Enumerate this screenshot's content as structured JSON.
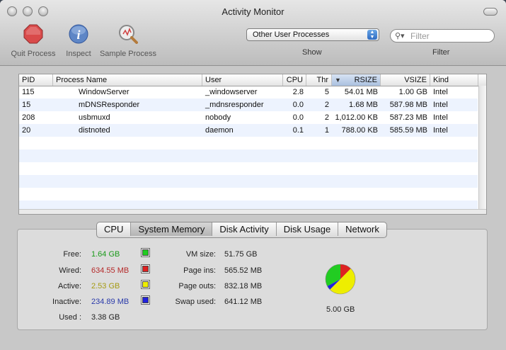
{
  "window": {
    "title": "Activity Monitor"
  },
  "toolbar": {
    "quit_label": "Quit Process",
    "inspect_label": "Inspect",
    "sample_label": "Sample Process",
    "show_value": "Other User Processes",
    "show_label": "Show",
    "filter_placeholder": "Filter",
    "filter_label": "Filter"
  },
  "table": {
    "headers": [
      "PID",
      "Process Name",
      "User",
      "CPU",
      "Thr",
      "RSIZE",
      "VSIZE",
      "Kind"
    ],
    "sorted_column": "RSIZE",
    "rows": [
      [
        "115",
        "WindowServer",
        "_windowserver",
        "2.8",
        "5",
        "54.01 MB",
        "1.00 GB",
        "Intel"
      ],
      [
        "15",
        "mDNSResponder",
        "_mdnsresponder",
        "0.0",
        "2",
        "1.68 MB",
        "587.98 MB",
        "Intel"
      ],
      [
        "208",
        "usbmuxd",
        "nobody",
        "0.0",
        "2",
        "1,012.00 KB",
        "587.23 MB",
        "Intel"
      ],
      [
        "20",
        "distnoted",
        "daemon",
        "0.1",
        "1",
        "788.00 KB",
        "585.59 MB",
        "Intel"
      ]
    ]
  },
  "tabs": [
    "CPU",
    "System Memory",
    "Disk Activity",
    "Disk Usage",
    "Network"
  ],
  "active_tab": "System Memory",
  "memory": {
    "free_label": "Free:",
    "free_value": "1.64 GB",
    "free_color": "#22cc22",
    "wired_label": "Wired:",
    "wired_value": "634.55 MB",
    "wired_color": "#dd2222",
    "active_label": "Active:",
    "active_value": "2.53 GB",
    "active_color": "#eeee00",
    "inactive_label": "Inactive:",
    "inactive_value": "234.89 MB",
    "inactive_color": "#2222dd",
    "used_label": "Used :",
    "used_value": "3.38 GB",
    "vm_label": "VM size:",
    "vm_value": "51.75 GB",
    "pageins_label": "Page ins:",
    "pageins_value": "565.52 MB",
    "pageouts_label": "Page outs:",
    "pageouts_value": "832.18 MB",
    "swap_label": "Swap used:",
    "swap_value": "641.12 MB",
    "total_value": "5.00 GB"
  },
  "pie_fractions": {
    "free": 0.328,
    "wired": 0.124,
    "active": 0.502,
    "inactive": 0.046
  }
}
